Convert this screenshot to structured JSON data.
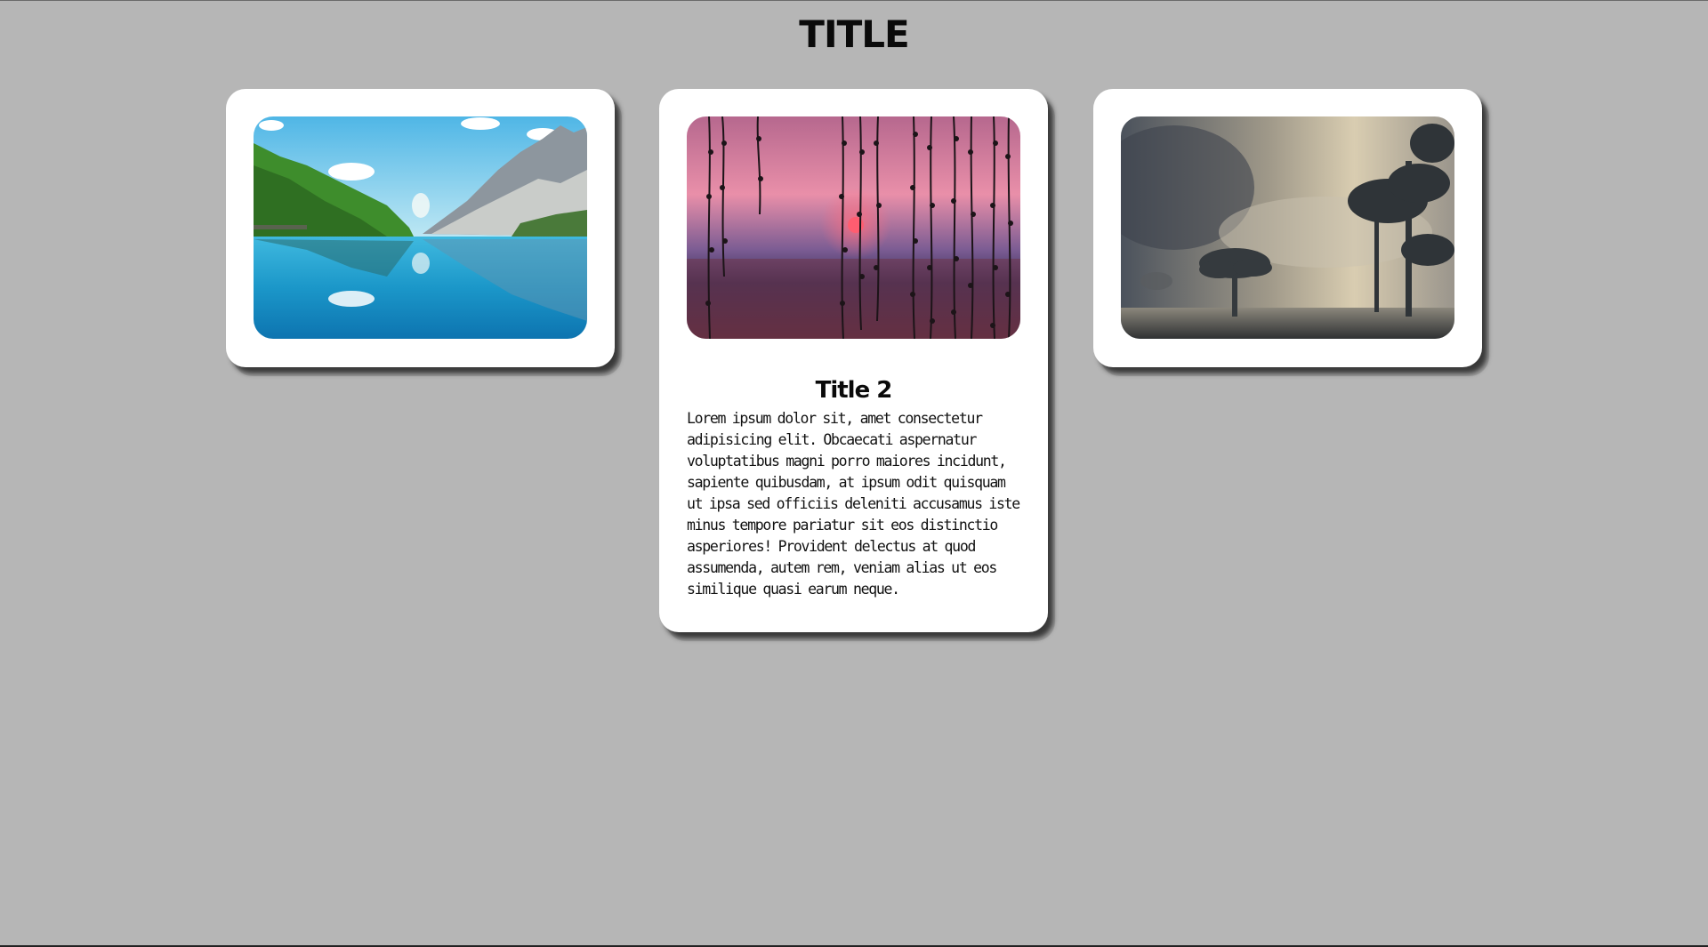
{
  "page": {
    "title": "TITLE",
    "background_color": "#b6b6b6"
  },
  "cards": [
    {
      "image": {
        "subject": "mountain-lake-reflection"
      },
      "expanded": false
    },
    {
      "image": {
        "subject": "sunset-willow-branches"
      },
      "expanded": true,
      "title": "Title 2",
      "text": "Lorem ipsum dolor sit, amet consectetur adipisicing elit. Obcaecati aspernatur voluptatibus magni porro maiores incidunt, sapiente quibusdam, at ipsum odit quisquam ut ipsa sed officiis deleniti accusamus iste minus tempore pariatur sit eos distinctio asperiores! Provident delectus at quod assumenda, autem rem, veniam alias ut eos similique quasi earum neque."
    },
    {
      "image": {
        "subject": "foggy-trees-landscape"
      },
      "expanded": false
    }
  ]
}
